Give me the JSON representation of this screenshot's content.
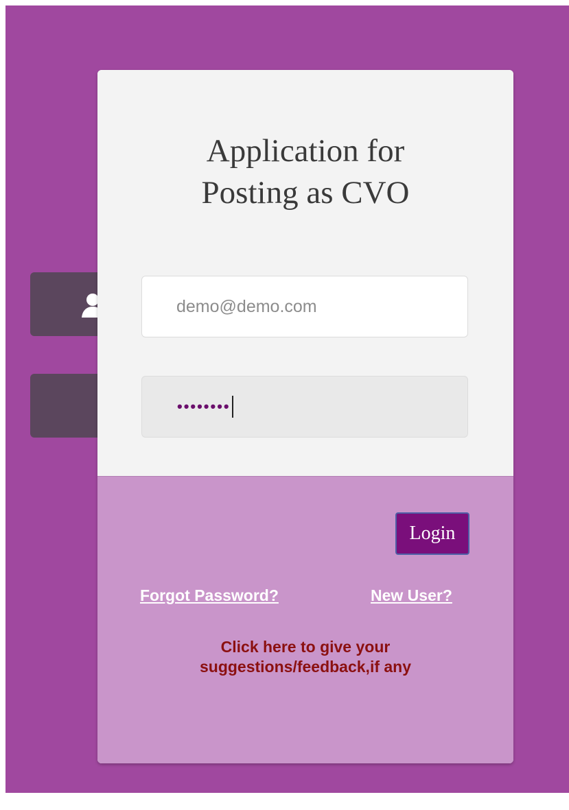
{
  "colors": {
    "page_background": "#a0489f",
    "side_tab": "#5b465d",
    "card_top": "#f3f3f3",
    "card_bottom": "#c995ca",
    "login_button": "#7a0f7b",
    "feedback_text": "#8b1010",
    "link_text": "#ffffff"
  },
  "side_tabs": {
    "user_icon": "user-icon",
    "lock_icon": ""
  },
  "form": {
    "title_line1": "Application for",
    "title_line2": "Posting as CVO",
    "email_placeholder": "demo@demo.com",
    "email_value": "",
    "password_masked": "••••••••",
    "login_label": "Login"
  },
  "links": {
    "forgot_password": "Forgot Password?",
    "new_user": "New User?",
    "feedback_line1": "Click here to give your",
    "feedback_line2": "suggestions/feedback,if any"
  }
}
